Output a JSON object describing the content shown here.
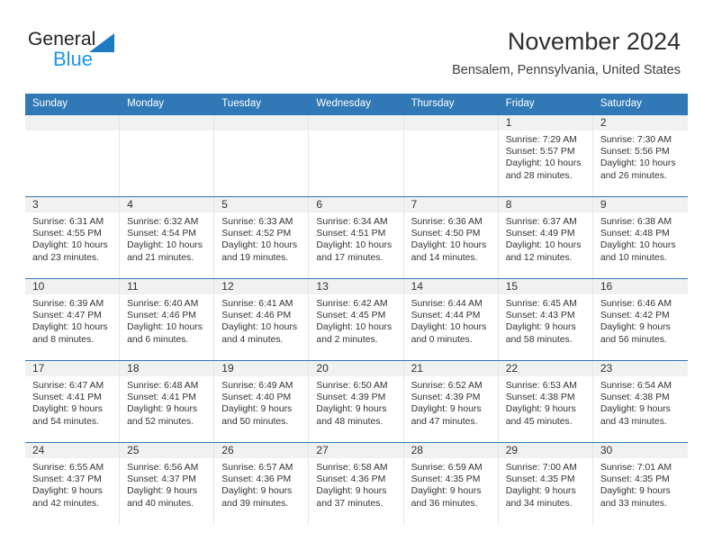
{
  "brand": {
    "name_part1": "General",
    "name_part2": "Blue",
    "accent_color": "#2196e3",
    "triangle_color": "#1f7bc1"
  },
  "header": {
    "title": "November 2024",
    "location": "Bensalem, Pennsylvania, United States"
  },
  "calendar": {
    "header_bg": "#3079b6",
    "weekday_headers": [
      "Sunday",
      "Monday",
      "Tuesday",
      "Wednesday",
      "Thursday",
      "Friday",
      "Saturday"
    ],
    "weeks": [
      [
        {
          "date": "",
          "empty": true
        },
        {
          "date": "",
          "empty": true
        },
        {
          "date": "",
          "empty": true
        },
        {
          "date": "",
          "empty": true
        },
        {
          "date": "",
          "empty": true
        },
        {
          "date": "1",
          "sunrise": "Sunrise: 7:29 AM",
          "sunset": "Sunset: 5:57 PM",
          "daylight_line1": "Daylight: 10 hours",
          "daylight_line2": "and 28 minutes."
        },
        {
          "date": "2",
          "sunrise": "Sunrise: 7:30 AM",
          "sunset": "Sunset: 5:56 PM",
          "daylight_line1": "Daylight: 10 hours",
          "daylight_line2": "and 26 minutes."
        }
      ],
      [
        {
          "date": "3",
          "sunrise": "Sunrise: 6:31 AM",
          "sunset": "Sunset: 4:55 PM",
          "daylight_line1": "Daylight: 10 hours",
          "daylight_line2": "and 23 minutes."
        },
        {
          "date": "4",
          "sunrise": "Sunrise: 6:32 AM",
          "sunset": "Sunset: 4:54 PM",
          "daylight_line1": "Daylight: 10 hours",
          "daylight_line2": "and 21 minutes."
        },
        {
          "date": "5",
          "sunrise": "Sunrise: 6:33 AM",
          "sunset": "Sunset: 4:52 PM",
          "daylight_line1": "Daylight: 10 hours",
          "daylight_line2": "and 19 minutes."
        },
        {
          "date": "6",
          "sunrise": "Sunrise: 6:34 AM",
          "sunset": "Sunset: 4:51 PM",
          "daylight_line1": "Daylight: 10 hours",
          "daylight_line2": "and 17 minutes."
        },
        {
          "date": "7",
          "sunrise": "Sunrise: 6:36 AM",
          "sunset": "Sunset: 4:50 PM",
          "daylight_line1": "Daylight: 10 hours",
          "daylight_line2": "and 14 minutes."
        },
        {
          "date": "8",
          "sunrise": "Sunrise: 6:37 AM",
          "sunset": "Sunset: 4:49 PM",
          "daylight_line1": "Daylight: 10 hours",
          "daylight_line2": "and 12 minutes."
        },
        {
          "date": "9",
          "sunrise": "Sunrise: 6:38 AM",
          "sunset": "Sunset: 4:48 PM",
          "daylight_line1": "Daylight: 10 hours",
          "daylight_line2": "and 10 minutes."
        }
      ],
      [
        {
          "date": "10",
          "sunrise": "Sunrise: 6:39 AM",
          "sunset": "Sunset: 4:47 PM",
          "daylight_line1": "Daylight: 10 hours",
          "daylight_line2": "and 8 minutes."
        },
        {
          "date": "11",
          "sunrise": "Sunrise: 6:40 AM",
          "sunset": "Sunset: 4:46 PM",
          "daylight_line1": "Daylight: 10 hours",
          "daylight_line2": "and 6 minutes."
        },
        {
          "date": "12",
          "sunrise": "Sunrise: 6:41 AM",
          "sunset": "Sunset: 4:46 PM",
          "daylight_line1": "Daylight: 10 hours",
          "daylight_line2": "and 4 minutes."
        },
        {
          "date": "13",
          "sunrise": "Sunrise: 6:42 AM",
          "sunset": "Sunset: 4:45 PM",
          "daylight_line1": "Daylight: 10 hours",
          "daylight_line2": "and 2 minutes."
        },
        {
          "date": "14",
          "sunrise": "Sunrise: 6:44 AM",
          "sunset": "Sunset: 4:44 PM",
          "daylight_line1": "Daylight: 10 hours",
          "daylight_line2": "and 0 minutes."
        },
        {
          "date": "15",
          "sunrise": "Sunrise: 6:45 AM",
          "sunset": "Sunset: 4:43 PM",
          "daylight_line1": "Daylight: 9 hours",
          "daylight_line2": "and 58 minutes."
        },
        {
          "date": "16",
          "sunrise": "Sunrise: 6:46 AM",
          "sunset": "Sunset: 4:42 PM",
          "daylight_line1": "Daylight: 9 hours",
          "daylight_line2": "and 56 minutes."
        }
      ],
      [
        {
          "date": "17",
          "sunrise": "Sunrise: 6:47 AM",
          "sunset": "Sunset: 4:41 PM",
          "daylight_line1": "Daylight: 9 hours",
          "daylight_line2": "and 54 minutes."
        },
        {
          "date": "18",
          "sunrise": "Sunrise: 6:48 AM",
          "sunset": "Sunset: 4:41 PM",
          "daylight_line1": "Daylight: 9 hours",
          "daylight_line2": "and 52 minutes."
        },
        {
          "date": "19",
          "sunrise": "Sunrise: 6:49 AM",
          "sunset": "Sunset: 4:40 PM",
          "daylight_line1": "Daylight: 9 hours",
          "daylight_line2": "and 50 minutes."
        },
        {
          "date": "20",
          "sunrise": "Sunrise: 6:50 AM",
          "sunset": "Sunset: 4:39 PM",
          "daylight_line1": "Daylight: 9 hours",
          "daylight_line2": "and 48 minutes."
        },
        {
          "date": "21",
          "sunrise": "Sunrise: 6:52 AM",
          "sunset": "Sunset: 4:39 PM",
          "daylight_line1": "Daylight: 9 hours",
          "daylight_line2": "and 47 minutes."
        },
        {
          "date": "22",
          "sunrise": "Sunrise: 6:53 AM",
          "sunset": "Sunset: 4:38 PM",
          "daylight_line1": "Daylight: 9 hours",
          "daylight_line2": "and 45 minutes."
        },
        {
          "date": "23",
          "sunrise": "Sunrise: 6:54 AM",
          "sunset": "Sunset: 4:38 PM",
          "daylight_line1": "Daylight: 9 hours",
          "daylight_line2": "and 43 minutes."
        }
      ],
      [
        {
          "date": "24",
          "sunrise": "Sunrise: 6:55 AM",
          "sunset": "Sunset: 4:37 PM",
          "daylight_line1": "Daylight: 9 hours",
          "daylight_line2": "and 42 minutes."
        },
        {
          "date": "25",
          "sunrise": "Sunrise: 6:56 AM",
          "sunset": "Sunset: 4:37 PM",
          "daylight_line1": "Daylight: 9 hours",
          "daylight_line2": "and 40 minutes."
        },
        {
          "date": "26",
          "sunrise": "Sunrise: 6:57 AM",
          "sunset": "Sunset: 4:36 PM",
          "daylight_line1": "Daylight: 9 hours",
          "daylight_line2": "and 39 minutes."
        },
        {
          "date": "27",
          "sunrise": "Sunrise: 6:58 AM",
          "sunset": "Sunset: 4:36 PM",
          "daylight_line1": "Daylight: 9 hours",
          "daylight_line2": "and 37 minutes."
        },
        {
          "date": "28",
          "sunrise": "Sunrise: 6:59 AM",
          "sunset": "Sunset: 4:35 PM",
          "daylight_line1": "Daylight: 9 hours",
          "daylight_line2": "and 36 minutes."
        },
        {
          "date": "29",
          "sunrise": "Sunrise: 7:00 AM",
          "sunset": "Sunset: 4:35 PM",
          "daylight_line1": "Daylight: 9 hours",
          "daylight_line2": "and 34 minutes."
        },
        {
          "date": "30",
          "sunrise": "Sunrise: 7:01 AM",
          "sunset": "Sunset: 4:35 PM",
          "daylight_line1": "Daylight: 9 hours",
          "daylight_line2": "and 33 minutes."
        }
      ]
    ]
  }
}
